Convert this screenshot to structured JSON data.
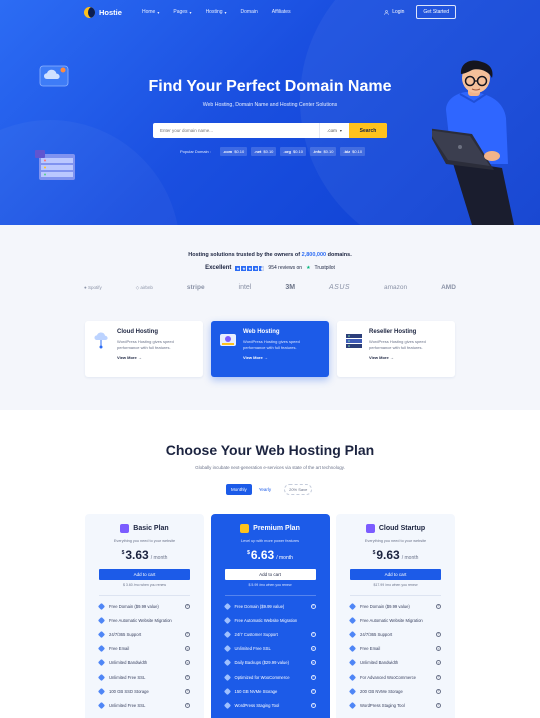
{
  "brand": {
    "name": "Hostie"
  },
  "nav": {
    "items": [
      {
        "label": "Home",
        "has_dropdown": true
      },
      {
        "label": "Pages",
        "has_dropdown": true
      },
      {
        "label": "Hosting",
        "has_dropdown": true
      },
      {
        "label": "Domain",
        "has_dropdown": false
      },
      {
        "label": "Affiliates",
        "has_dropdown": false
      }
    ],
    "login_label": "Login",
    "cta_label": "Get Started"
  },
  "hero": {
    "title": "Find Your Perfect Domain Name",
    "subtitle": "Web Hosting, Domain Name and Hosting Center Solutions",
    "search_placeholder": "Enter your domain name...",
    "tld_selected": ".com",
    "search_button": "Search",
    "popular_label": "Popular Domain :",
    "popular_domains": [
      {
        "tld": ".com",
        "price": "$0.10"
      },
      {
        "tld": ".net",
        "price": "$0.10"
      },
      {
        "tld": ".org",
        "price": "$0.10"
      },
      {
        "tld": ".info",
        "price": "$0.10"
      },
      {
        "tld": ".biz",
        "price": "$0.10"
      }
    ]
  },
  "trust": {
    "line_prefix": "Hosting solutions trusted by the owners of",
    "line_highlight": "2,800,000",
    "line_suffix": "domains.",
    "rating_word": "Excellent",
    "reviews_text": "954 reviews on",
    "reviews_platform": "Trustpilot",
    "brands": [
      "Spotify",
      "airbnb",
      "stripe",
      "intel",
      "3M",
      "ASUS",
      "amazon",
      "AMD"
    ]
  },
  "services": [
    {
      "title": "Cloud Hosting",
      "desc": "WordPress Hosting gives speed performance with full features.",
      "link": "View More"
    },
    {
      "title": "Web Hosting",
      "desc": "WordPress Hosting gives speed performance with full features.",
      "link": "View More"
    },
    {
      "title": "Reseller Hosting",
      "desc": "WordPress Hosting gives speed performance with full features.",
      "link": "View More"
    }
  ],
  "plans": {
    "title": "Choose Your Web Hosting Plan",
    "subtitle": "Globally incubate next-generation e-services via state of the art technology.",
    "toggle_monthly": "Monthly",
    "toggle_yearly": "Yearly",
    "save_label": "20% Save",
    "cards": [
      {
        "name": "Basic Plan",
        "tagline": "Everything you need to your website",
        "currency": "$",
        "price": "3.63",
        "period": "/ month",
        "cta": "Add to cart",
        "renew": "$ 3.60 /mo when you renew",
        "icon_color": "#7b5cff",
        "features": [
          "Free Domain ($9.99 value)",
          "Free Automatic Website Migration",
          "24/7/365 Support",
          "Free Email",
          "Unlimited Bandwidth",
          "Unlimited Free SSL",
          "100 GB SSD Storage",
          "Unlimited Free SSL"
        ]
      },
      {
        "name": "Premium Plan",
        "tagline": "Level up with more power features",
        "currency": "$",
        "price": "6.63",
        "period": "/ month",
        "cta": "Add to cart",
        "renew": "$ 5.99 /mo when you renew",
        "icon_color": "#ffc21c",
        "features": [
          "Free Domain ($9.99 value)",
          "Free Automatic Website Migration",
          "24/7 Customer Support",
          "Unlimited Free SSL",
          "Daily Backups ($29.99 value)",
          "Optimized for WooCommerce",
          "150 GB NVMe Storage",
          "WordPress Staging Tool"
        ]
      },
      {
        "name": "Cloud Startup",
        "tagline": "Everything you need to your website",
        "currency": "$",
        "price": "9.63",
        "period": "/ month",
        "cta": "Add to cart",
        "renew": "$17.99 /mo when you renew",
        "icon_color": "#7b5cff",
        "features": [
          "Free Domain ($9.99 value)",
          "Free Automatic Website Migration",
          "24/7/365 Support",
          "Free Email",
          "Unlimited Bandwidth",
          "For Advanced WooCommerce",
          "200 GB NVMe Storage",
          "WordPress Staging Tool"
        ]
      }
    ]
  }
}
